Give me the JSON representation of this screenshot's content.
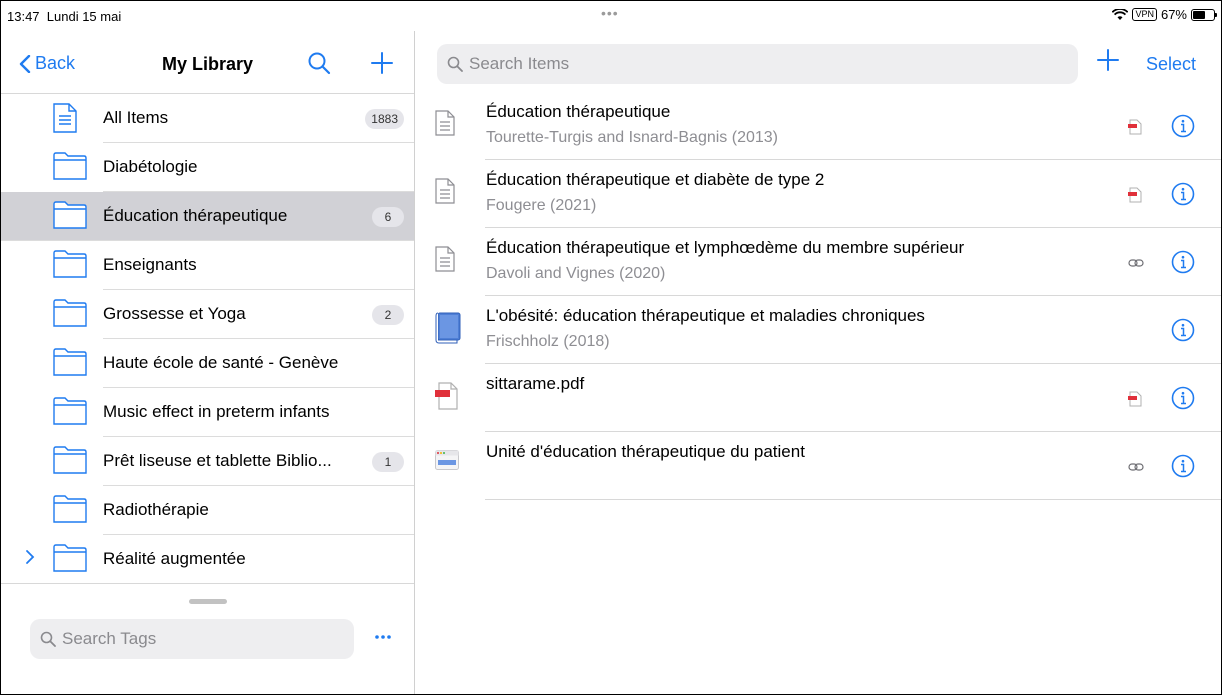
{
  "status": {
    "time": "13:47",
    "date": "Lundi 15 mai",
    "multitask": "•••",
    "vpn": "VPN",
    "battery_text": "67%",
    "battery_level": 0.67
  },
  "sidebar": {
    "back_label": "Back",
    "title": "My Library",
    "collections": [
      {
        "label": "All Items",
        "count": "1883",
        "icon": "document-icon",
        "selected": false
      },
      {
        "label": "Diabétologie",
        "count": "",
        "icon": "folder-icon",
        "selected": false
      },
      {
        "label": "Éducation thérapeutique",
        "count": "6",
        "icon": "folder-icon",
        "selected": true
      },
      {
        "label": "Enseignants",
        "count": "",
        "icon": "folder-icon",
        "selected": false
      },
      {
        "label": "Grossesse et Yoga",
        "count": "2",
        "icon": "folder-icon",
        "selected": false
      },
      {
        "label": "Haute école de santé - Genève",
        "count": "",
        "icon": "folder-icon",
        "selected": false
      },
      {
        "label": "Music effect in preterm infants",
        "count": "",
        "icon": "folder-icon",
        "selected": false
      },
      {
        "label": "Prêt liseuse et tablette Biblio...",
        "count": "1",
        "icon": "folder-icon",
        "selected": false
      },
      {
        "label": "Radiothérapie",
        "count": "",
        "icon": "folder-icon",
        "selected": false
      },
      {
        "label": "Réalité augmentée",
        "count": "",
        "icon": "folder-icon",
        "selected": false,
        "expandable": true
      }
    ],
    "tags_placeholder": "Search Tags"
  },
  "main": {
    "search_placeholder": "Search Items",
    "select_label": "Select",
    "items": [
      {
        "title": "Éducation thérapeutique",
        "subtitle": "Tourette-Turgis and Isnard-Bagnis (2013)",
        "type_icon": "document-icon",
        "attachment_icon": "pdf-icon"
      },
      {
        "title": "Éducation thérapeutique et diabète de type 2",
        "subtitle": "Fougere (2021)",
        "type_icon": "document-icon",
        "attachment_icon": "pdf-icon"
      },
      {
        "title": "Éducation thérapeutique et lymphœdème du membre supérieur",
        "subtitle": "Davoli and Vignes (2020)",
        "type_icon": "document-icon",
        "attachment_icon": "link-icon"
      },
      {
        "title": "L'obésité: éducation thérapeutique et maladies chroniques",
        "subtitle": "Frischholz (2018)",
        "type_icon": "book-icon",
        "attachment_icon": ""
      },
      {
        "title": "sittarame.pdf",
        "subtitle": "",
        "type_icon": "pdf-file-icon",
        "attachment_icon": "pdf-icon"
      },
      {
        "title": "Unité d'éducation thérapeutique du patient",
        "subtitle": "",
        "type_icon": "webpage-icon",
        "attachment_icon": "link-icon"
      }
    ]
  },
  "colors": {
    "accent": "#1f7bf0",
    "selected_row": "#d1d1d6",
    "pdf_red": "#e0303a"
  }
}
